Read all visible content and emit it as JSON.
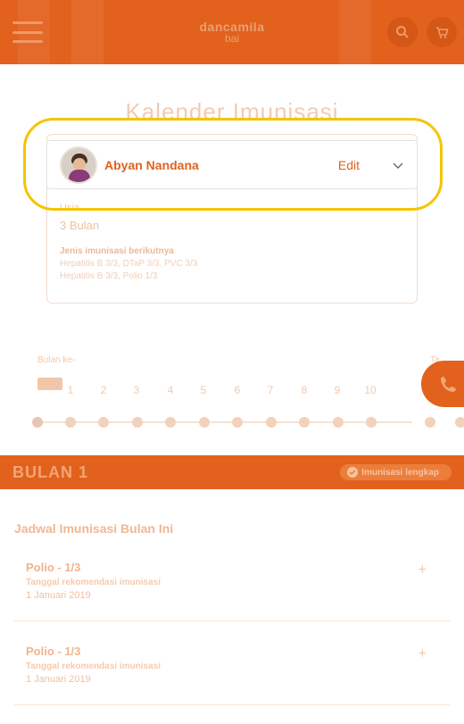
{
  "header": {
    "logo_line1": "dancamila",
    "logo_line2": "bai",
    "icons": [
      "menu-icon",
      "search-icon",
      "cart-icon"
    ],
    "brand_color": "#e2611d"
  },
  "page": {
    "title": "Kalender Imunisasi"
  },
  "info_card": {
    "age_label": "Usia",
    "age_value": "3 Bulan",
    "next_label": "Jenis imunisasi berikutnya",
    "next_items": [
      "Hepatitis B 3/3, DTaP 3/3, PVC 3/3",
      "Hepatitis B 3/3, Polio 1/3"
    ]
  },
  "modal": {
    "child_name": "Abyan Nandana",
    "edit_label": "Edit",
    "highlight_color": "#f5c400"
  },
  "months": {
    "left_label": "Bulan ke-",
    "right_label": "Ta",
    "items": [
      "0",
      "1",
      "2",
      "3",
      "4",
      "5",
      "6",
      "7",
      "8",
      "9",
      "10"
    ]
  },
  "current_month": {
    "title": "BULAN 1",
    "status": "Imunisasi lengkap"
  },
  "schedule": {
    "title": "Jadwal Imunisasi Bulan Ini",
    "items": [
      {
        "name": "Polio - 1/3",
        "date_label": "Tanggal rekomendasi imunisasi",
        "date": "1 Januari 2019"
      },
      {
        "name": "Polio - 1/3",
        "date_label": "Tanggal rekomendasi imunisasi",
        "date": "1 Januari 2019"
      }
    ]
  }
}
